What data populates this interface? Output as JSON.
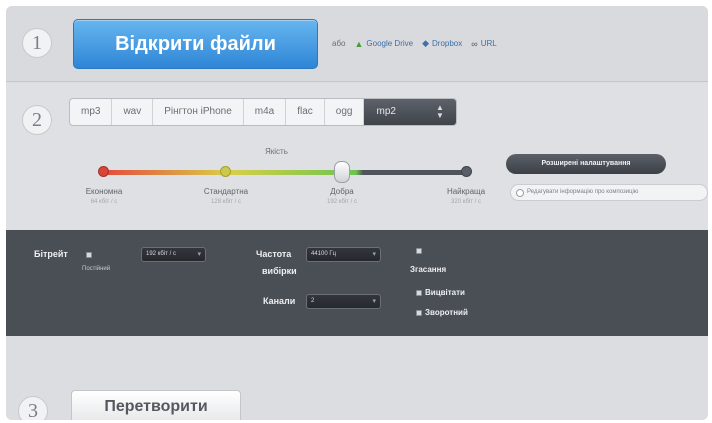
{
  "steps": {
    "one": "1",
    "two": "2",
    "three": "3"
  },
  "open_files": {
    "label": "Відкрити файли"
  },
  "sources": [
    {
      "label": "або",
      "icon": ""
    },
    {
      "label": "Google Drive",
      "icon": "google-drive-icon"
    },
    {
      "label": "Dropbox",
      "icon": "dropbox-icon"
    },
    {
      "label": "URL",
      "icon": "link-icon"
    }
  ],
  "formats": {
    "items": [
      "mp3",
      "wav",
      "Рінгтон iPhone",
      "m4a",
      "flac",
      "ogg"
    ],
    "selected": "mp2"
  },
  "quality": {
    "title": "Якість",
    "levels": [
      {
        "label": "Економна",
        "sub": "64 кбіт / с"
      },
      {
        "label": "Стандартна",
        "sub": "128 кбіт / с"
      },
      {
        "label": "Добра",
        "sub": "192 кбіт / с"
      },
      {
        "label": "Найкраща",
        "sub": "320 кбіт / с"
      }
    ],
    "selected_index": 2
  },
  "advanced_button": "Розширені налаштування",
  "ringtone_option": "Редагувати інформацію про композицію",
  "settings": {
    "bitrate_label": "Бітрейт",
    "constant_label": "Постійний",
    "bitrate_value": "192 кбіт / с",
    "frequency_label": "Частота",
    "frequency_sub": "вибірки",
    "frequency_value": "44100 Гц",
    "channels_label": "Канали",
    "channels_value": "2",
    "fade_label": "Згасання",
    "fade_in": "Вицвітати",
    "reverse": "Зворотний"
  },
  "convert_button": "Перетворити",
  "colors": {
    "accent_blue": "#2f86d6",
    "panel_dark": "#4a4e55"
  }
}
